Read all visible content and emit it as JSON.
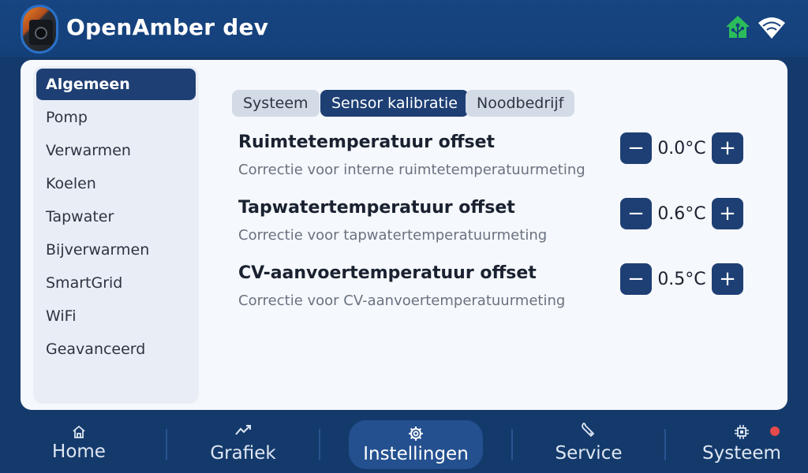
{
  "header": {
    "title": "OpenAmber dev",
    "icons": [
      "home-assistant-icon",
      "wifi-icon"
    ],
    "home_icon_color": "#2bbd5b"
  },
  "sidebar": {
    "items": [
      {
        "label": "Algemeen",
        "active": true
      },
      {
        "label": "Pomp"
      },
      {
        "label": "Verwarmen"
      },
      {
        "label": "Koelen"
      },
      {
        "label": "Tapwater"
      },
      {
        "label": "Bijverwarmen"
      },
      {
        "label": "SmartGrid"
      },
      {
        "label": "WiFi"
      },
      {
        "label": "Geavanceerd"
      }
    ]
  },
  "tabs": [
    {
      "label": "Systeem"
    },
    {
      "label": "Sensor kalibratie",
      "active": true
    },
    {
      "label": "Noodbedrijf"
    }
  ],
  "settings": [
    {
      "title": "Ruimtetemperatuur offset",
      "description": "Correctie voor interne ruimtetemperatuurmeting",
      "value": "0.0°C"
    },
    {
      "title": "Tapwatertemperatuur offset",
      "description": "Correctie voor tapwatertemperatuurmeting",
      "value": "0.6°C"
    },
    {
      "title": "CV-aanvoertemperatuur offset",
      "description": "Correctie voor CV-aanvoertemperatuurmeting",
      "value": "0.5°C"
    }
  ],
  "stepper": {
    "minus": "−",
    "plus": "+"
  },
  "nav": [
    {
      "label": "Home",
      "icon": "home-icon"
    },
    {
      "label": "Grafiek",
      "icon": "chart-icon"
    },
    {
      "label": "Instellingen",
      "icon": "gear-icon",
      "active": true
    },
    {
      "label": "Service",
      "icon": "wrench-icon"
    },
    {
      "label": "Systeem",
      "icon": "chip-icon"
    }
  ],
  "colors": {
    "accent": "#1e3f74",
    "background": "#143a6b",
    "alert": "#e64a4a"
  }
}
